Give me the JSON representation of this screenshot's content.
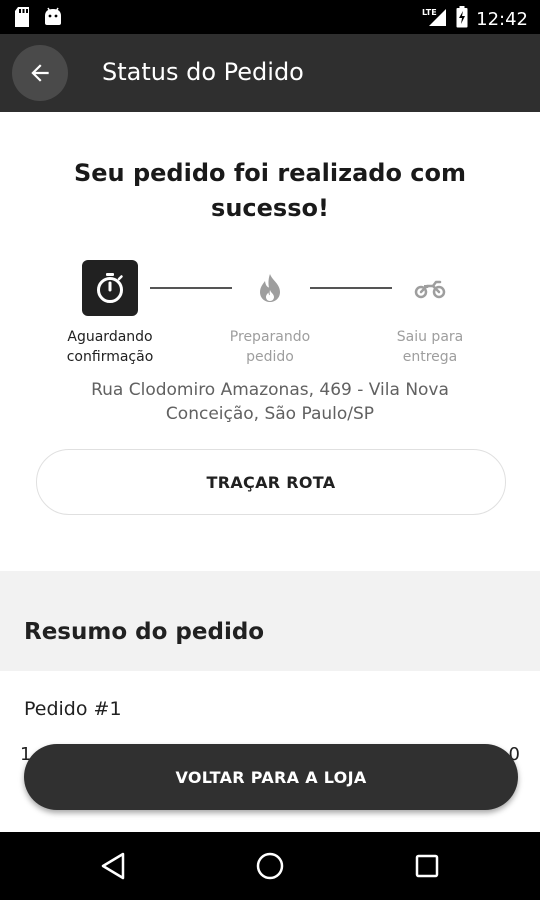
{
  "status_bar": {
    "time": "12:42",
    "network": "LTE",
    "icons": [
      "sd-card-icon",
      "android-icon",
      "signal-icon",
      "battery-charging-icon"
    ]
  },
  "app_bar": {
    "title": "Status do Pedido",
    "back_icon": "arrow-back-icon"
  },
  "headline": "Seu pedido foi realizado com sucesso!",
  "steps": [
    {
      "line1": "Aguardando",
      "line2": "confirmação",
      "icon": "timer-icon",
      "active": true
    },
    {
      "line1": "Preparando",
      "line2": "pedido",
      "icon": "flame-icon",
      "active": false
    },
    {
      "line1": "Saiu para",
      "line2": "entrega",
      "icon": "motorcycle-icon",
      "active": false
    }
  ],
  "address": {
    "line1": "Rua Clodomiro Amazonas, 469 - Vila Nova",
    "line2": "Conceição, São Paulo/SP"
  },
  "route_button": "TRAÇAR ROTA",
  "summary": {
    "title": "Resumo do pedido",
    "order_label": "Pedido #1",
    "peek_left": "1",
    "peek_right": "0"
  },
  "back_to_store_button": "VOLTAR PARA A LOJA",
  "colors": {
    "app_bar": "#2f2f2f",
    "button_dark": "#303030",
    "summary_band": "#f2f2f2",
    "inactive_text": "#9e9e9e"
  }
}
